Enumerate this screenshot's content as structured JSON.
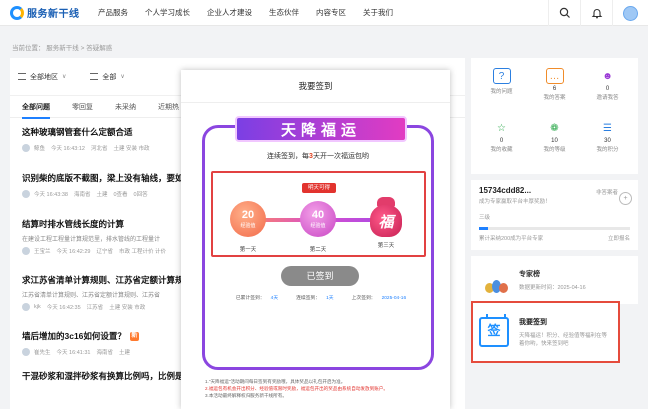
{
  "header": {
    "logo": "服务新干线",
    "nav": [
      "产品服务",
      "个人学习成长",
      "企业人才建设",
      "生态伙伴",
      "内容专区",
      "关于我们"
    ]
  },
  "breadcrumb": "当前位置： 服务新干线 > 答疑解惑",
  "filters": {
    "area": "全部地区",
    "all": "全部"
  },
  "tabs": [
    "全部问题",
    "零回复",
    "未采纳",
    "近期热"
  ],
  "questions": [
    {
      "title": "这种玻璃钢管套什么定额合适",
      "user": "鲸鱼",
      "time": "今天 16:43:12",
      "region": "河北省",
      "tags": "土建 安装 市政"
    },
    {
      "title": "识别柴的底版不截图，梁上没有轴线，要如何",
      "user": "",
      "time": "今天 16:43:38",
      "region": "海南省",
      "tags": "土建",
      "views": "0查看",
      "answers": "0回答"
    },
    {
      "title": "结算时排水管线长度的计算",
      "desc": "在建设工程工程量计算规范里，排水管线的工程量计",
      "user": "王宝兰",
      "time": "今天 16:42:29",
      "region": "辽宁省",
      "tags": "市政 工程计价 计价"
    },
    {
      "title": "求江苏省清单计算规则、江苏省定额计算规则",
      "desc": "江苏省清单计算规则、江苏省定额计算规则、江苏省",
      "user": "kjk",
      "time": "今天 16:42:35",
      "region": "江苏省",
      "tags": "土建 安装 市政"
    },
    {
      "title": "墙后增加的3c16如何设置？",
      "user": "崔先生",
      "time": "今天 16:41:31",
      "region": "海南省",
      "tags": "土建",
      "badge": "新"
    },
    {
      "title": "干混砂浆和湿拌砂浆有换算比例吗，比例是多少"
    }
  ],
  "modal": {
    "title": "我要签到",
    "banner": "天降福运",
    "subtitle_pre": "连续签到，每",
    "subtitle_num": "3",
    "subtitle_post": "天开一次福运包哟",
    "tomorrow": "明天可得",
    "day1_value": "20",
    "day1_unit": "经验值",
    "day1_label": "第一天",
    "day2_value": "40",
    "day2_unit": "经验值",
    "day2_label": "第二天",
    "day3_label": "第三天",
    "bag_char": "福",
    "signed_button": "已签到",
    "stat_total_label": "已累计签到：",
    "stat_total_value": "4天",
    "stat_continuous_label": "连续签到：",
    "stat_continuous_value": "1天",
    "stat_last_label": "上次签到：",
    "stat_last_value": "2025-04-16",
    "rule1": "1.\"天降福运\"活动期间每日签到有奖励哦，具体奖品以礼包开启为准。",
    "rule2": "2.福运包有机会开出积分、经验值或限时奖励，福运包开出的奖品由系统自动发放到账户。",
    "rule3": "3.本活动最终解释权归服务新干线所有。"
  },
  "side": {
    "grid": [
      {
        "num": "",
        "label": "我的问题",
        "icon": "question-icon"
      },
      {
        "num": "6",
        "label": "我的答案",
        "icon": "answer-icon"
      },
      {
        "num": "0",
        "label": "邀请我答",
        "icon": "invite-icon"
      },
      {
        "num": "0",
        "label": "我的收藏",
        "icon": "star-icon"
      },
      {
        "num": "10",
        "label": "我的等级",
        "icon": "leaf-icon"
      },
      {
        "num": "30",
        "label": "我的积分",
        "icon": "coins-icon"
      }
    ],
    "user_card": {
      "name": "15734cdd82...",
      "tag": "非答案者",
      "role": "成为专家赢取平台丰厚奖励！",
      "level": "三级",
      "progress_text": "累计采纳200成为平台专家",
      "action": "立即报名",
      "progress": 0.06
    },
    "expert": {
      "title": "专家榜",
      "date": "数据更新时间：2025-04-16"
    },
    "sign": {
      "title": "我要签到",
      "desc": "天降福运！积分、经验值等福利在等着你哟，快来签到吧",
      "icon_char": "签"
    }
  }
}
